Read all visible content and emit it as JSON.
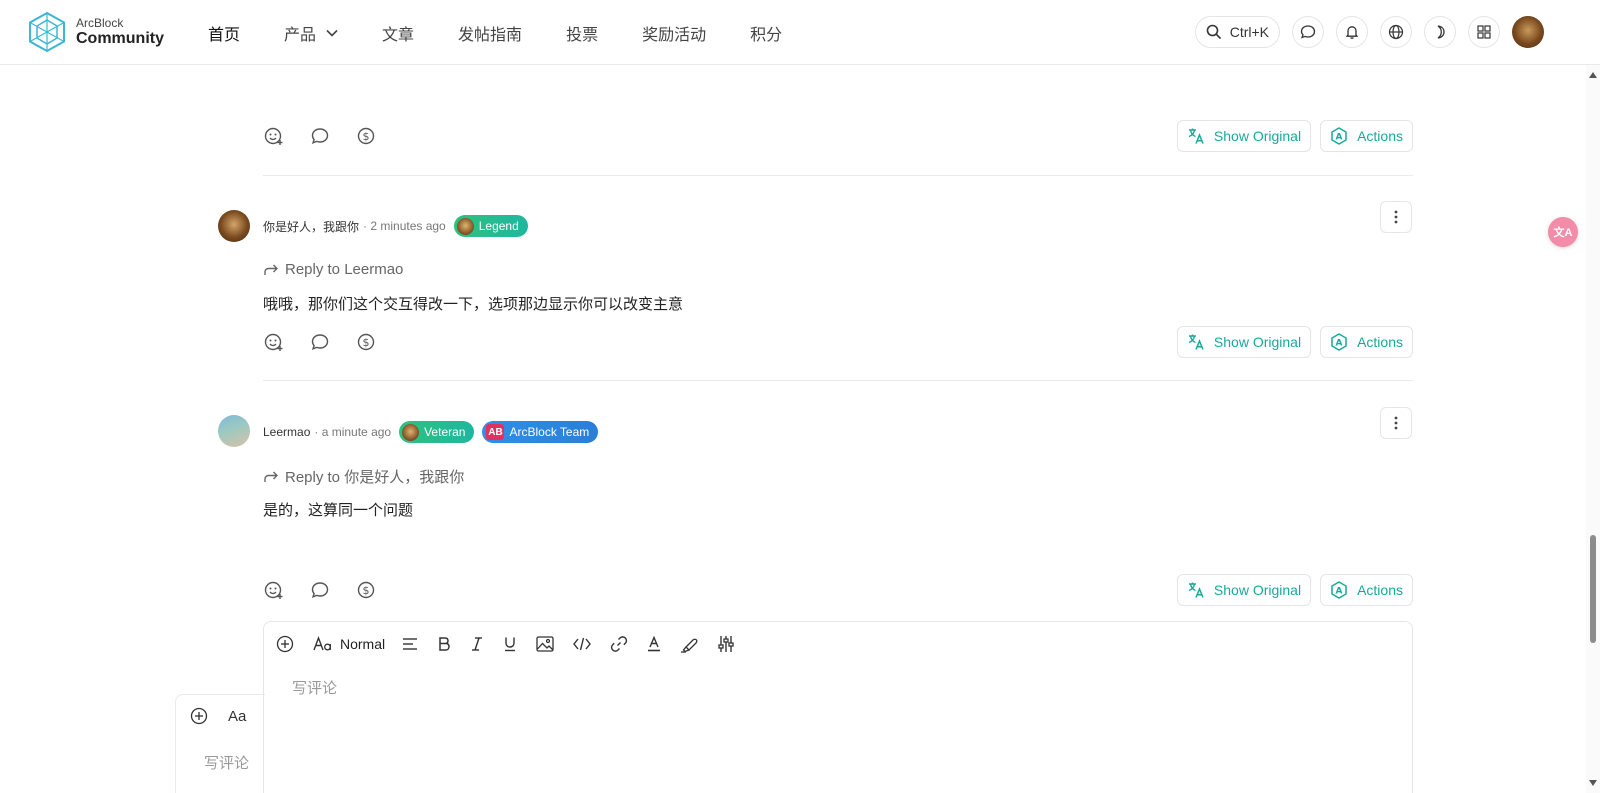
{
  "header": {
    "logo_top": "ArcBlock",
    "logo_bottom": "Community",
    "nav": [
      {
        "label": "首页"
      },
      {
        "label": "产品"
      },
      {
        "label": "文章"
      },
      {
        "label": "发帖指南"
      },
      {
        "label": "投票"
      },
      {
        "label": "奖励活动"
      },
      {
        "label": "积分"
      }
    ],
    "search_shortcut": "Ctrl+K",
    "icons": [
      "search-icon",
      "chat-icon",
      "bell-icon",
      "globe-icon",
      "moon-icon",
      "apps-icon"
    ]
  },
  "buttons": {
    "show_original": "Show Original",
    "actions": "Actions"
  },
  "comments": [
    {
      "author": "你是好人，我跟你",
      "time": "· 2 minutes ago",
      "badges": [
        {
          "label": "Legend",
          "color": "#2ec27e"
        }
      ],
      "reply_to": "Reply to Leermao",
      "body": "哦哦，那你们这个交互得改一下，选项那边显示你可以改变主意"
    },
    {
      "author": "Leermao",
      "time": "· a minute ago",
      "badges": [
        {
          "label": "Veteran",
          "color": "#2ec27e"
        },
        {
          "label": "ArcBlock Team",
          "icon_text": "AB",
          "color": "#2f8fe6"
        }
      ],
      "reply_to": "Reply to 你是好人，我跟你",
      "body": "是的，这算同一个问题"
    }
  ],
  "editor": {
    "format_label": "Normal",
    "placeholder": "写评论",
    "ghost_format_label": "Aa",
    "ghost_placeholder": "写评论"
  },
  "floating": {
    "translate_icon_text": "文A"
  },
  "colors": {
    "accent": "#19a99a",
    "legend_badge": "#2ec27e",
    "team_badge": "#2f8fe6"
  }
}
